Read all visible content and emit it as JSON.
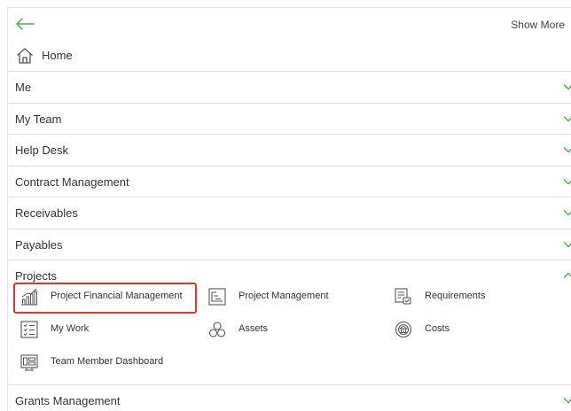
{
  "topbar": {
    "show_more_label": "Show More"
  },
  "home": {
    "label": "Home"
  },
  "groups": [
    {
      "label": "Me",
      "expanded": false
    },
    {
      "label": "My Team",
      "expanded": false
    },
    {
      "label": "Help Desk",
      "expanded": false
    },
    {
      "label": "Contract Management",
      "expanded": false
    },
    {
      "label": "Receivables",
      "expanded": false
    },
    {
      "label": "Payables",
      "expanded": false
    },
    {
      "label": "Projects",
      "expanded": true
    },
    {
      "label": "Grants Management",
      "expanded": false
    }
  ],
  "projects_apps": [
    {
      "label": "Project Financial Management",
      "icon": "bar-chart-icon",
      "selected": true
    },
    {
      "label": "Project Management",
      "icon": "gantt-chart-icon",
      "selected": false
    },
    {
      "label": "Requirements",
      "icon": "requirements-icon",
      "selected": false
    },
    {
      "label": "My Work",
      "icon": "checklist-icon",
      "selected": false
    },
    {
      "label": "Assets",
      "icon": "assets-icon",
      "selected": false
    },
    {
      "label": "Costs",
      "icon": "costs-icon",
      "selected": false
    },
    {
      "label": "Team Member Dashboard",
      "icon": "dashboard-icon",
      "selected": false
    }
  ],
  "colors": {
    "accent": "#4caf50",
    "selection": "#d9372f",
    "divider": "#e0e0e0"
  }
}
